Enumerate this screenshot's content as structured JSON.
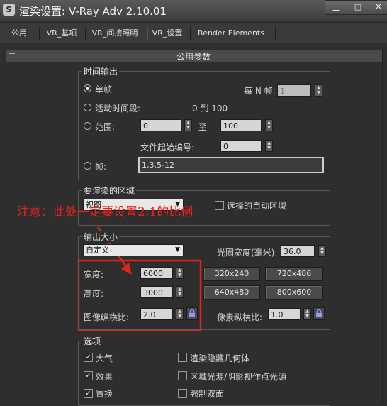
{
  "window": {
    "title": "渲染设置: V-Ray Adv 2.10.01",
    "icon_letter": "S"
  },
  "tabs": [
    "公用",
    "VR_基项",
    "VR_间接照明",
    "VR_设置",
    "Render Elements"
  ],
  "rollout": {
    "toggle": "−",
    "title": "公用参数"
  },
  "time_output": {
    "label": "时间输出",
    "single": "单帧",
    "every_n_label": "每 N 帧:",
    "every_n_value": "1",
    "active_segment": "活动时间段:",
    "active_range": "0 到 100",
    "range": "范围:",
    "range_from": "0",
    "range_to_label": "至",
    "range_to": "100",
    "file_start_label": "文件起始编号:",
    "file_start": "0",
    "frames": "帧:",
    "frames_value": "1,3,5-12"
  },
  "render_area": {
    "label": "要渲染的区域",
    "type": "视图",
    "auto_region": "选择的自动区域"
  },
  "annotation": "注意：此处一定要设置2:1的比例",
  "output_size": {
    "label": "输出大小",
    "preset": "自定义",
    "aperture_label": "光圈宽度(毫米):",
    "aperture_value": "36.0",
    "width_label": "宽度:",
    "width": "6000",
    "height_label": "高度:",
    "height": "3000",
    "image_aspect_label": "图像纵横比:",
    "image_aspect": "2.0",
    "pixel_aspect_label": "像素纵横比:",
    "pixel_aspect": "1.0",
    "presets": [
      "320x240",
      "720x486",
      "640x480",
      "800x600"
    ]
  },
  "options": {
    "label": "选项",
    "atmosphere": "大气",
    "effects": "效果",
    "displacement": "置换",
    "render_hidden": "渲染隐藏几何体",
    "area_lights": "区域光源/阴影视作点光源",
    "force_two_sided": "强制双面"
  }
}
